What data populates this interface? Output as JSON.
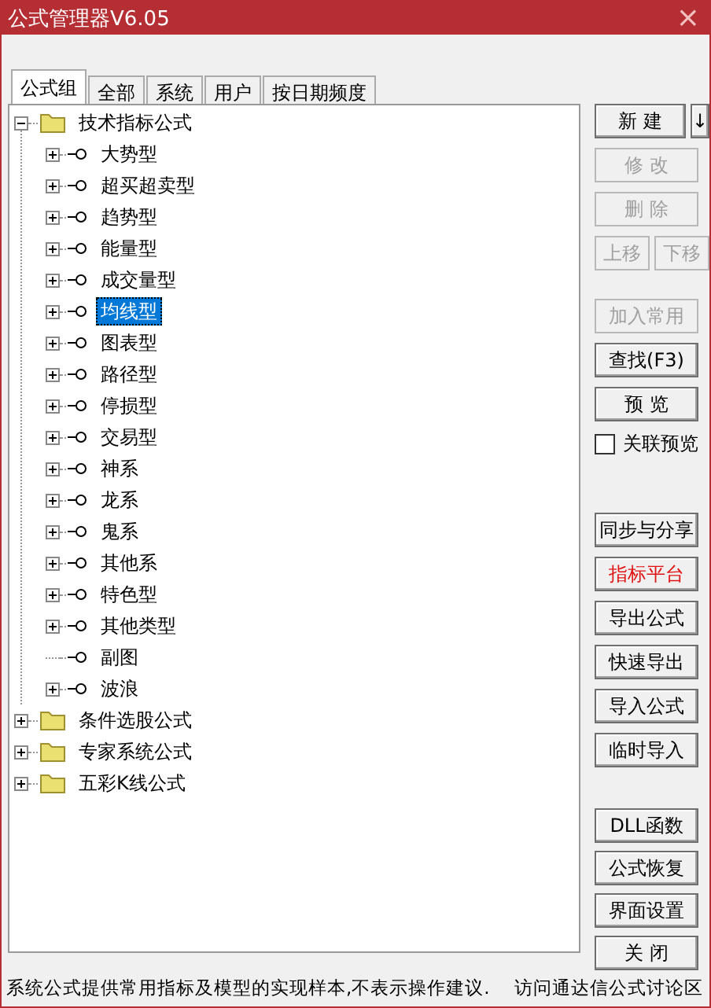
{
  "window": {
    "title": "公式管理器V6.05",
    "close": "×"
  },
  "tabs": [
    {
      "label": "公式组",
      "selected": true
    },
    {
      "label": "全部",
      "selected": false
    },
    {
      "label": "系统",
      "selected": false
    },
    {
      "label": "用户",
      "selected": false
    },
    {
      "label": "按日期频度",
      "selected": false
    }
  ],
  "tree": [
    {
      "label": "技术指标公式",
      "expanded": true,
      "children": [
        {
          "label": "大势型",
          "expandable": true,
          "selected": false
        },
        {
          "label": "超买超卖型",
          "expandable": true,
          "selected": false
        },
        {
          "label": "趋势型",
          "expandable": true,
          "selected": false
        },
        {
          "label": "能量型",
          "expandable": true,
          "selected": false
        },
        {
          "label": "成交量型",
          "expandable": true,
          "selected": false
        },
        {
          "label": "均线型",
          "expandable": true,
          "selected": true
        },
        {
          "label": "图表型",
          "expandable": true,
          "selected": false
        },
        {
          "label": "路径型",
          "expandable": true,
          "selected": false
        },
        {
          "label": "停损型",
          "expandable": true,
          "selected": false
        },
        {
          "label": "交易型",
          "expandable": true,
          "selected": false
        },
        {
          "label": "神系",
          "expandable": true,
          "selected": false
        },
        {
          "label": "龙系",
          "expandable": true,
          "selected": false
        },
        {
          "label": "鬼系",
          "expandable": true,
          "selected": false
        },
        {
          "label": "其他系",
          "expandable": true,
          "selected": false
        },
        {
          "label": "特色型",
          "expandable": true,
          "selected": false
        },
        {
          "label": "其他类型",
          "expandable": true,
          "selected": false
        },
        {
          "label": "副图",
          "expandable": false,
          "selected": false
        },
        {
          "label": "波浪",
          "expandable": true,
          "selected": false
        }
      ]
    },
    {
      "label": "条件选股公式",
      "expanded": false
    },
    {
      "label": "专家系统公式",
      "expanded": false
    },
    {
      "label": "五彩K线公式",
      "expanded": false
    }
  ],
  "side_groups": [
    {
      "rows": [
        [
          {
            "kind": "button",
            "label": "新 建",
            "disabled": false,
            "highlight": false
          },
          {
            "kind": "arrow",
            "label": "↓",
            "disabled": false,
            "highlight": false
          }
        ],
        [
          {
            "kind": "button",
            "label": "修 改",
            "disabled": true,
            "highlight": false
          }
        ],
        [
          {
            "kind": "button",
            "label": "删 除",
            "disabled": true,
            "highlight": false
          }
        ],
        [
          {
            "kind": "button",
            "label": "上移",
            "disabled": true,
            "highlight": false
          },
          {
            "kind": "button",
            "label": "下移",
            "disabled": true,
            "highlight": false
          }
        ]
      ]
    },
    {
      "rows": [
        [
          {
            "kind": "button",
            "label": "加入常用",
            "disabled": true,
            "highlight": false
          }
        ],
        [
          {
            "kind": "button",
            "label": "查找(F3)",
            "disabled": false,
            "highlight": false
          }
        ],
        [
          {
            "kind": "button",
            "label": "预 览",
            "disabled": false,
            "highlight": false
          }
        ],
        [
          {
            "kind": "checkbox",
            "label": "关联预览",
            "checked": false
          }
        ]
      ]
    },
    {
      "rows": [
        [
          {
            "kind": "button",
            "label": "同步与分享",
            "disabled": false,
            "highlight": false
          }
        ],
        [
          {
            "kind": "button",
            "label": "指标平台",
            "disabled": false,
            "highlight": true
          }
        ],
        [
          {
            "kind": "button",
            "label": "导出公式",
            "disabled": false,
            "highlight": false
          }
        ],
        [
          {
            "kind": "button",
            "label": "快速导出",
            "disabled": false,
            "highlight": false
          }
        ],
        [
          {
            "kind": "button",
            "label": "导入公式",
            "disabled": false,
            "highlight": false
          }
        ],
        [
          {
            "kind": "button",
            "label": "临时导入",
            "disabled": false,
            "highlight": false
          }
        ]
      ]
    },
    {
      "rows": [
        [
          {
            "kind": "button",
            "label": "DLL函数",
            "disabled": false,
            "highlight": false
          }
        ],
        [
          {
            "kind": "button",
            "label": "公式恢复",
            "disabled": false,
            "highlight": false
          }
        ],
        [
          {
            "kind": "button",
            "label": "界面设置",
            "disabled": false,
            "highlight": false
          }
        ],
        [
          {
            "kind": "button",
            "label": "关 闭",
            "disabled": false,
            "highlight": false
          }
        ]
      ]
    }
  ],
  "status_bar": {
    "note": "系统公式提供常用指标及模型的实现样本,不表示操作建议.",
    "link": "访问通达信公式讨论区"
  }
}
